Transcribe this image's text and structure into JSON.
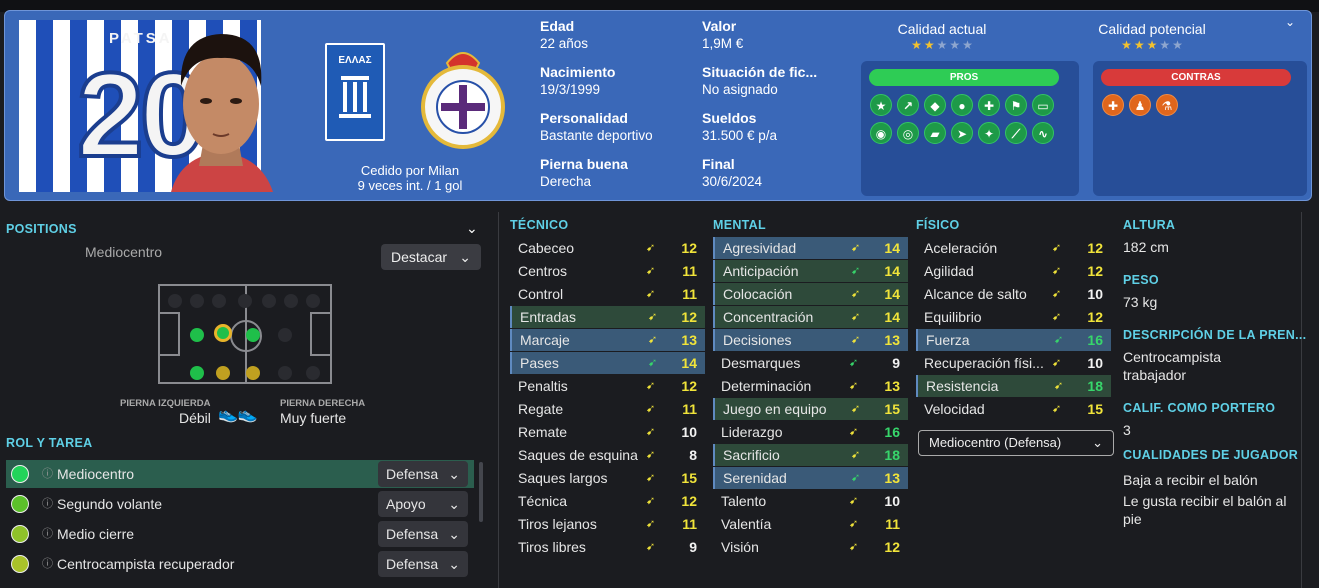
{
  "player": {
    "shirt_name": "PATSA",
    "shirt_number": "20",
    "loan_text": "Cedido por Milan",
    "caps_text": "9 veces int. / 1 gol",
    "flag_text": "ΕΛΛΑΣ"
  },
  "info": [
    {
      "k": "Edad",
      "v": "22 años"
    },
    {
      "k": "Valor",
      "v": "1,9M €"
    },
    {
      "k": "Nacimiento",
      "v": "19/3/1999"
    },
    {
      "k": "Situación de fic...",
      "v": "No asignado"
    },
    {
      "k": "Personalidad",
      "v": "Bastante deportivo"
    },
    {
      "k": "Sueldos",
      "v": "31.500 € p/a"
    },
    {
      "k": "Pierna buena",
      "v": "Derecha"
    },
    {
      "k": "Final",
      "v": "30/6/2024"
    }
  ],
  "ratings": {
    "current_label": "Calidad actual",
    "current_stars": 2,
    "potential_label": "Calidad potencial",
    "potential_stars": 3
  },
  "pros_label": "PROS",
  "contras_label": "CONTRAS",
  "pros_icons": [
    "star-icon",
    "trend-icon",
    "tag-icon",
    "head-icon",
    "bandage-icon",
    "flag-icon",
    "pitch-icon",
    "ball-icon",
    "target-icon",
    "boots-icon",
    "runner-icon",
    "tackle-icon",
    "stretch-icon",
    "pulse-icon"
  ],
  "contras_icons": [
    "medical-cross-icon",
    "fitness-icon",
    "flask-icon"
  ],
  "positions": {
    "title": "POSITIONS",
    "role": "Mediocentro",
    "highlight": "Destacar",
    "left_foot_label": "PIERNA IZQUIERDA",
    "left_foot": "Débil",
    "right_foot_label": "PIERNA DERECHA",
    "right_foot": "Muy fuerte"
  },
  "rol_title": "ROL Y TAREA",
  "roles": [
    {
      "name": "Mediocentro",
      "duty": "Defensa",
      "color": "#22d35a"
    },
    {
      "name": "Segundo volante",
      "duty": "Apoyo",
      "color": "#5cc02a"
    },
    {
      "name": "Medio cierre",
      "duty": "Defensa",
      "color": "#8fc12a"
    },
    {
      "name": "Centrocampista recuperador",
      "duty": "Defensa",
      "color": "#a9c22a"
    }
  ],
  "tecnico_title": "TÉCNICO",
  "tecnico": [
    {
      "n": "Cabeceo",
      "v": "12"
    },
    {
      "n": "Centros",
      "v": "11"
    },
    {
      "n": "Control",
      "v": "11"
    },
    {
      "n": "Entradas",
      "v": "12"
    },
    {
      "n": "Marcaje",
      "v": "13"
    },
    {
      "n": "Pases",
      "v": "14"
    },
    {
      "n": "Penaltis",
      "v": "12"
    },
    {
      "n": "Regate",
      "v": "11"
    },
    {
      "n": "Remate",
      "v": "10"
    },
    {
      "n": "Saques de esquina",
      "v": "8"
    },
    {
      "n": "Saques largos",
      "v": "15"
    },
    {
      "n": "Técnica",
      "v": "12"
    },
    {
      "n": "Tiros lejanos",
      "v": "11"
    },
    {
      "n": "Tiros libres",
      "v": "9"
    }
  ],
  "mental_title": "MENTAL",
  "mental": [
    {
      "n": "Agresividad",
      "v": "14"
    },
    {
      "n": "Anticipación",
      "v": "14"
    },
    {
      "n": "Colocación",
      "v": "14"
    },
    {
      "n": "Concentración",
      "v": "14"
    },
    {
      "n": "Decisiones",
      "v": "13"
    },
    {
      "n": "Desmarques",
      "v": "9"
    },
    {
      "n": "Determinación",
      "v": "13"
    },
    {
      "n": "Juego en equipo",
      "v": "15"
    },
    {
      "n": "Liderazgo",
      "v": "16"
    },
    {
      "n": "Sacrificio",
      "v": "18"
    },
    {
      "n": "Serenidad",
      "v": "13"
    },
    {
      "n": "Talento",
      "v": "10"
    },
    {
      "n": "Valentía",
      "v": "11"
    },
    {
      "n": "Visión",
      "v": "12"
    }
  ],
  "fisico_title": "FÍSICO",
  "fisico": [
    {
      "n": "Aceleración",
      "v": "12"
    },
    {
      "n": "Agilidad",
      "v": "12"
    },
    {
      "n": "Alcance de salto",
      "v": "10"
    },
    {
      "n": "Equilibrio",
      "v": "12"
    },
    {
      "n": "Fuerza",
      "v": "16"
    },
    {
      "n": "Recuperación físi...",
      "v": "10"
    },
    {
      "n": "Resistencia",
      "v": "18"
    },
    {
      "n": "Velocidad",
      "v": "15"
    }
  ],
  "role_select": "Mediocentro (Defensa)",
  "details": {
    "altura_title": "ALTURA",
    "altura": "182 cm",
    "peso_title": "PESO",
    "peso": "73 kg",
    "desc_title": "DESCRIPCIÓN DE LA PREN...",
    "desc": "Centrocampista trabajador",
    "gk_title": "CALIF. COMO PORTERO",
    "gk": "3",
    "cual_title": "CUALIDADES DE JUGADOR",
    "cual1": "Baja a recibir el balón",
    "cual2": "Le gusta recibir el balón al pie"
  },
  "colors": {
    "accent": "#5fd0e6",
    "header_bg": "#3a68b8",
    "pros": "#2ecc55",
    "contras": "#d83a3a",
    "val_yellow": "#f1e43a",
    "val_green": "#37d66b"
  }
}
